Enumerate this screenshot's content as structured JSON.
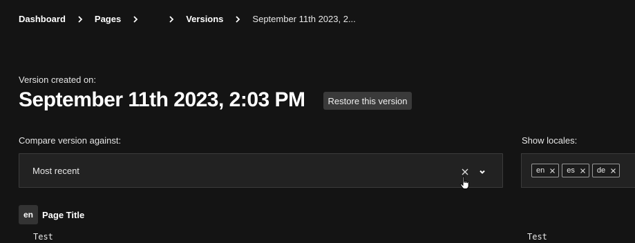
{
  "breadcrumb": {
    "items": [
      {
        "label": "Dashboard"
      },
      {
        "label": "Pages"
      },
      {
        "label": ""
      },
      {
        "label": "Versions"
      },
      {
        "label": "September 11th 2023, 2..."
      }
    ]
  },
  "version": {
    "created_label": "Version created on:",
    "title": "September 11th 2023, 2:03 PM",
    "restore_label": "Restore this version"
  },
  "compare": {
    "label": "Compare version against:",
    "selected": "Most recent"
  },
  "locales": {
    "label": "Show locales:",
    "chips": [
      "en",
      "es",
      "de"
    ]
  },
  "field": {
    "locale": "en",
    "title": "Page Title",
    "value_left": "Test",
    "value_right": "Test"
  },
  "icons": {
    "breadcrumb_separator": "chevron-right-icon",
    "clear": "close-icon",
    "dropdown": "chevron-down-icon",
    "chip_remove": "close-icon",
    "pointer": "hand-pointer-icon"
  }
}
